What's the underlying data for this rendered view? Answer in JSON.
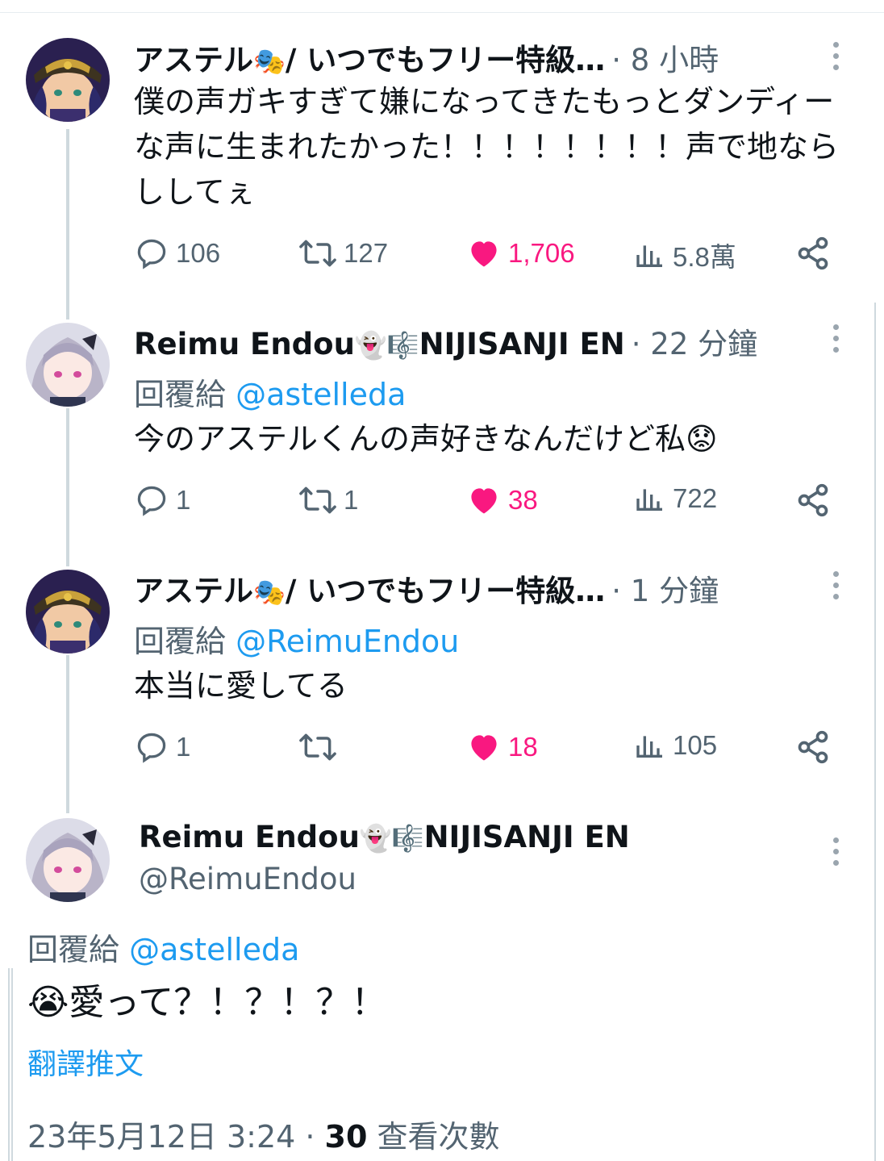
{
  "tweets": [
    {
      "author": "アステル",
      "author_suffix": " / いつでもフリー特級…",
      "emoji": "🎭",
      "time": "· 8 小時",
      "text": "僕の声ガキすぎて嫌になってきたもっとダンディーな声に生まれたかった！！！！！！！！声で地ならししてぇ",
      "replies": "106",
      "retweets": "127",
      "likes": "1,706",
      "views": "5.8萬"
    },
    {
      "author": "Reimu Endou",
      "author_suffix": "NIJISANJI EN",
      "emoji": "👻🎼",
      "time": "· 22 分鐘",
      "reply_prefix": "回覆給 ",
      "reply_to": "@astelleda",
      "text": "今のアステルくんの声好きなんだけど私😟",
      "replies": "1",
      "retweets": "1",
      "likes": "38",
      "views": "722"
    },
    {
      "author": "アステル",
      "author_suffix": " / いつでもフリー特級…",
      "emoji": "🎭",
      "time": "· 1 分鐘",
      "reply_prefix": "回覆給 ",
      "reply_to": "@ReimuEndou",
      "text": "本当に愛してる",
      "replies": "1",
      "retweets": "",
      "likes": "18",
      "views": "105"
    }
  ],
  "main_tweet": {
    "author": "Reimu Endou",
    "emoji": "👻🎼",
    "author_suffix": "NIJISANJI EN",
    "handle": "@ReimuEndou",
    "reply_prefix": "回覆給 ",
    "reply_to": "@astelleda",
    "text": "😭愛って？！？！？！",
    "translate": "翻譯推文",
    "date": "23年5月12日 3:24 · ",
    "views_count": "30",
    "views_label": " 查看次數"
  },
  "colors": {
    "like": "#f91880",
    "link": "#1d9bf0",
    "secondary": "#536471"
  },
  "icons": [
    "reply-icon",
    "retweet-icon",
    "heart-icon",
    "views-icon",
    "share-icon",
    "more-icon"
  ]
}
